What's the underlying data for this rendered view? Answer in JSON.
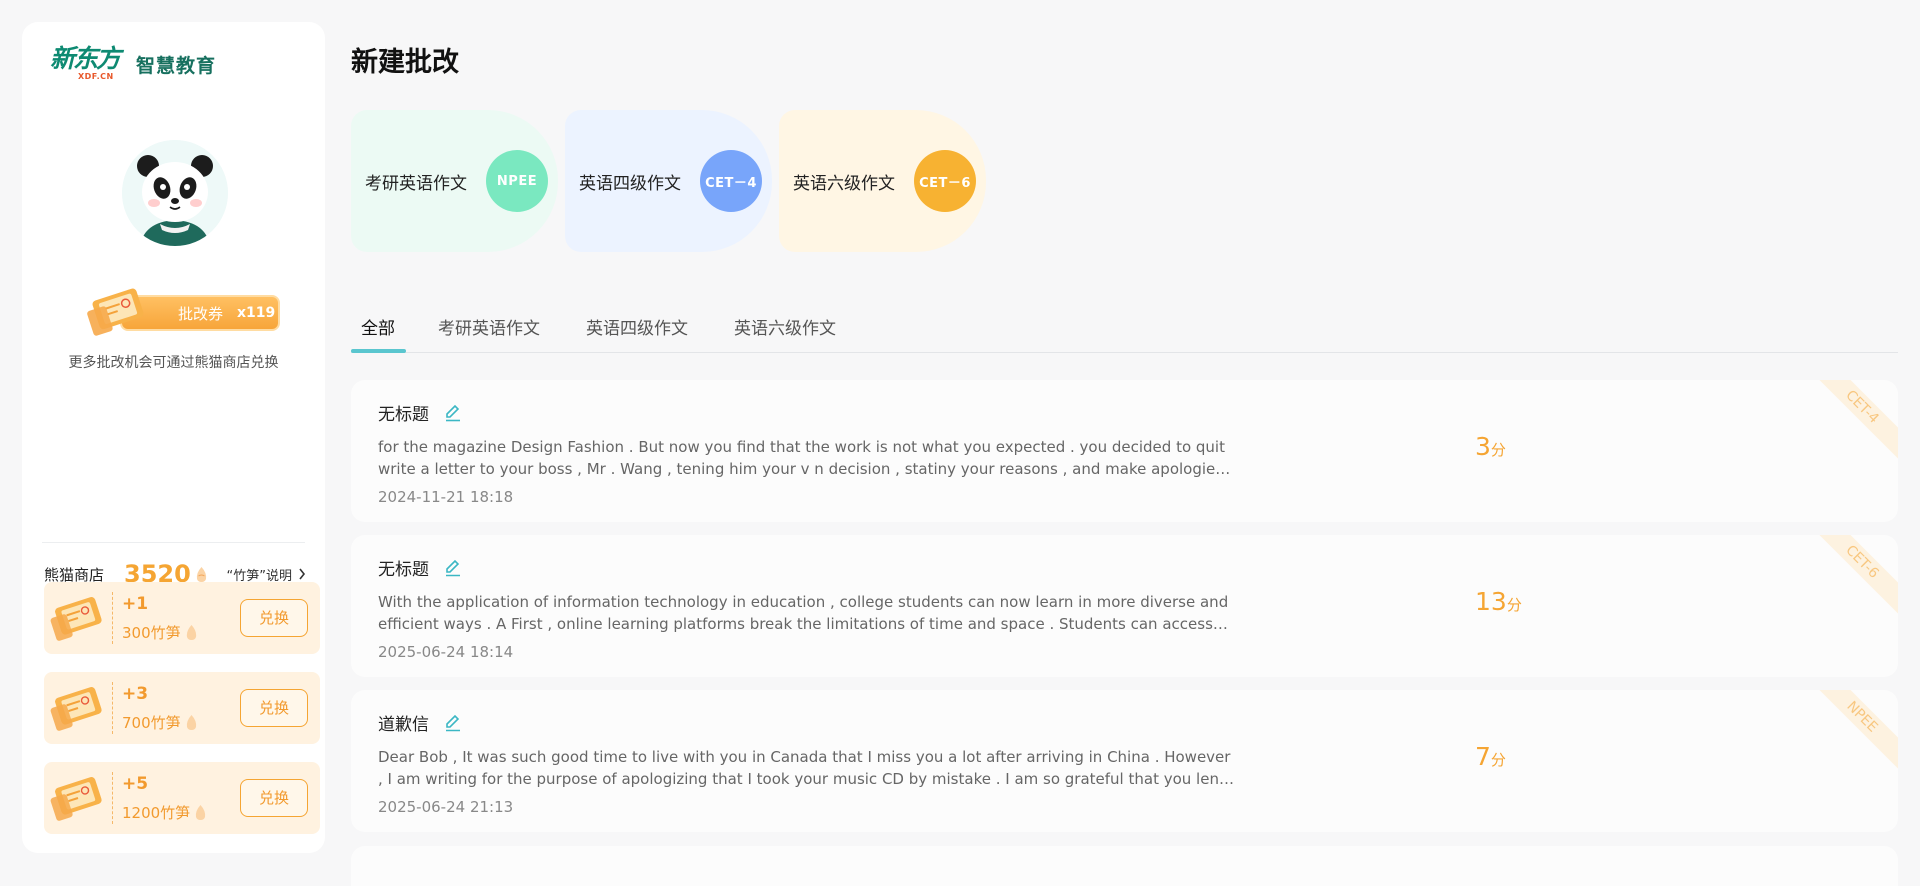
{
  "sidebar": {
    "logo_cn": "新东方",
    "logo_sub": "XDF.CN",
    "logo_text": "智慧教育",
    "coupon_label": "批改券",
    "coupon_count": "x119",
    "exchange_hint": "更多批改机会可通过熊猫商店兑换",
    "shop_title": "熊猫商店",
    "shop_points": "3520",
    "shop_explain": "“竹笋”说明",
    "shop_items": [
      {
        "plus": "+1",
        "price": "300竹笋",
        "button": "兑换"
      },
      {
        "plus": "+3",
        "price": "700竹笋",
        "button": "兑换"
      },
      {
        "plus": "+5",
        "price": "1200竹笋",
        "button": "兑换"
      }
    ]
  },
  "main": {
    "title": "新建批改",
    "categories": [
      {
        "label": "考研英语作文",
        "badge": "NPEE",
        "bg": "#ecfaf4",
        "badge_color": "#7ae8c0"
      },
      {
        "label": "英语四级作文",
        "badge": "CET－4",
        "bg": "#ecf3ff",
        "badge_color": "#78a5fa"
      },
      {
        "label": "英语六级作文",
        "badge": "CET－6",
        "bg": "#fff6e4",
        "badge_color": "#f7b232"
      }
    ],
    "tabs": [
      "全部",
      "考研英语作文",
      "英语四级作文",
      "英语六级作文"
    ],
    "cards": [
      {
        "title": "无标题",
        "excerpt": "for the magazine Design Fashion . But now you find that the work is not what you expected . you decided to quit write a letter to your boss , Mr . Wang , tening him your v n decision , statiny your reasons , and make apologies You should write at least",
        "date": "2024-11-21 18:18",
        "score": "3",
        "score_unit": "分",
        "ribbon": "CET-4"
      },
      {
        "title": "无标题",
        "excerpt": "With the application of information technology in education , college students can now learn in more diverse and efficient ways . A First , online learning platforms break the limitations of time and space . Students can access global courses via the internet",
        "date": "2025-06-24 18:14",
        "score": "13",
        "score_unit": "分",
        "ribbon": "CET-6"
      },
      {
        "title": "道歉信",
        "excerpt": "Dear Bob , It was such good time to live with you in Canada that I miss you a lot after arriving in China . However , I am writing for the purpose of apologizing that I took your music CD by mistake . I am so grateful that you lent the CD to me as",
        "date": "2025-06-24 21:13",
        "score": "7",
        "score_unit": "分",
        "ribbon": "NPEE"
      }
    ]
  },
  "colors": {
    "accent_teal": "#5ac6cf",
    "accent_orange": "#f5a533",
    "brand_green": "#0e8a72"
  },
  "icons": [
    "panda-avatar",
    "ticket-icon",
    "bamboo-icon",
    "chevron-right-icon",
    "edit-icon"
  ]
}
